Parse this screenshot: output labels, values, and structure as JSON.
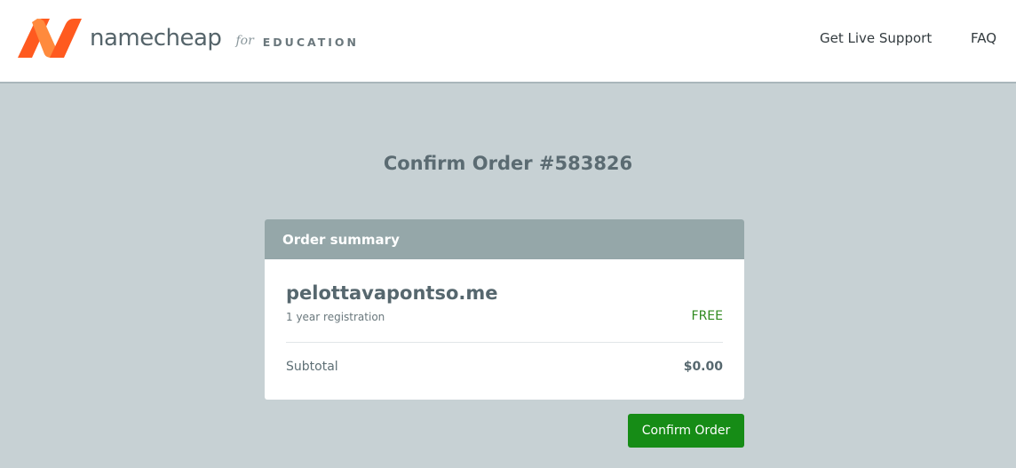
{
  "header": {
    "brand_name": "namecheap",
    "brand_for": "for",
    "brand_edu": "EDUCATION",
    "brand_colors": [
      "#ff5a1f",
      "#ff8a3d"
    ],
    "nav": {
      "support_label": "Get Live Support",
      "faq_label": "FAQ"
    }
  },
  "main": {
    "title": "Confirm Order #583826",
    "summary": {
      "heading": "Order summary",
      "item": {
        "domain": "pelottavapontso.me",
        "term": "1 year registration",
        "price": "FREE"
      },
      "subtotal_label": "Subtotal",
      "subtotal_value": "$0.00"
    },
    "confirm_label": "Confirm Order"
  },
  "colors": {
    "accent": "#168c16",
    "price": "#2f8a1f",
    "header_bg": "#ffffff",
    "page_bg": "#c7d1d4",
    "card_head_bg": "#95a7a9"
  }
}
